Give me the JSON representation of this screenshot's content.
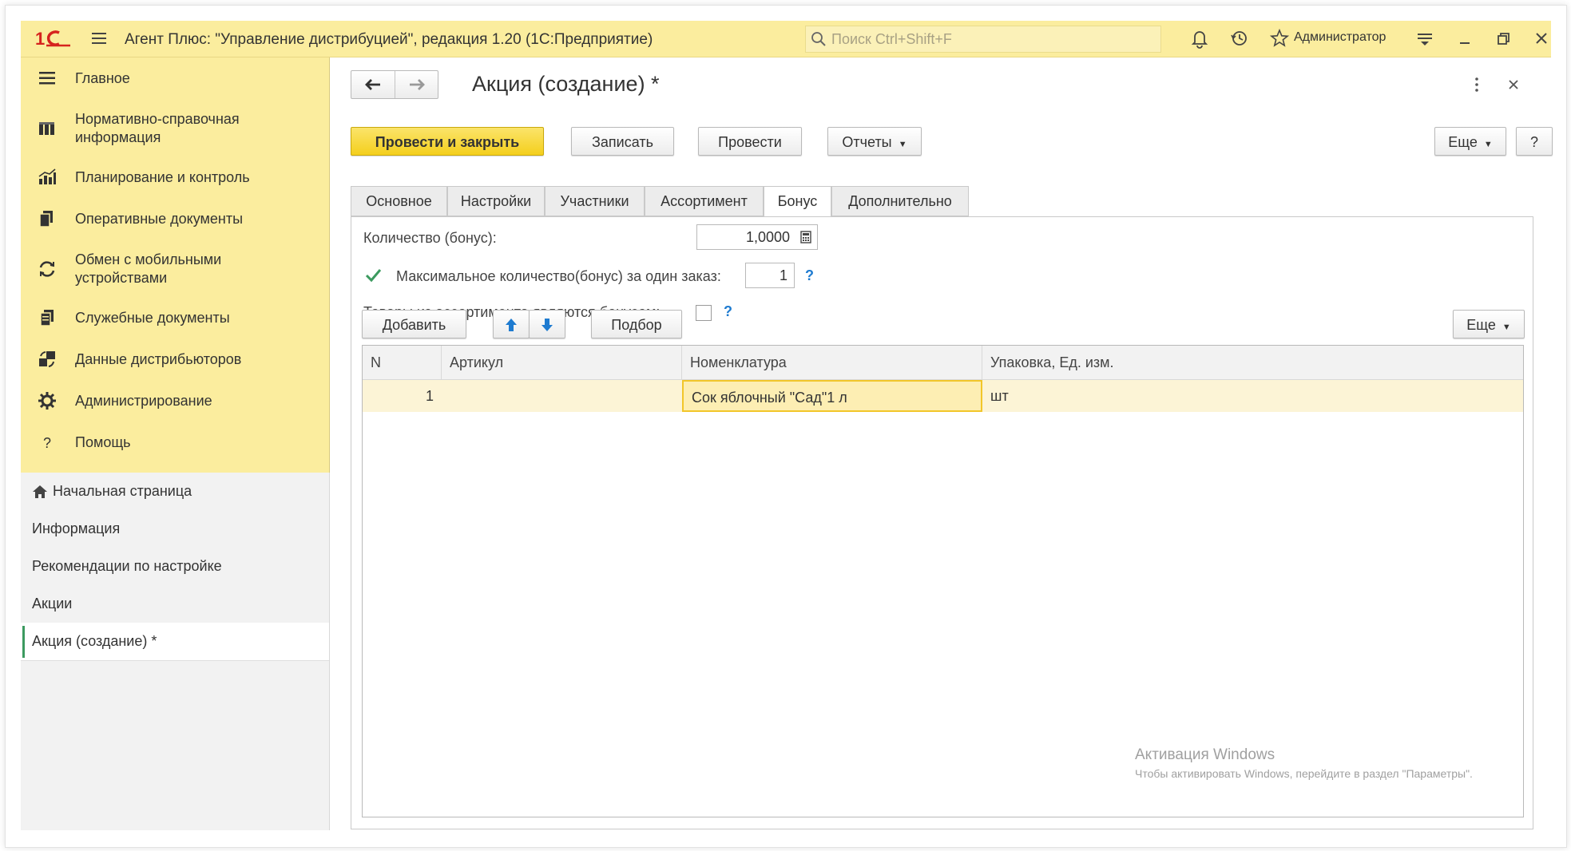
{
  "titlebar": {
    "app_title": "Агент Плюс: \"Управление дистрибуцией\", редакция 1.20  (1С:Предприятие)",
    "search_placeholder": "Поиск Ctrl+Shift+F",
    "user": "Администратор"
  },
  "sidebar": {
    "sections": [
      {
        "label": "Главное",
        "icon": "menu-icon"
      },
      {
        "label": "Нормативно-справочная информация",
        "icon": "catalog-icon"
      },
      {
        "label": "Планирование и контроль",
        "icon": "chart-icon"
      },
      {
        "label": "Оперативные документы",
        "icon": "documents-icon"
      },
      {
        "label": "Обмен с мобильными устройствами",
        "icon": "sync-icon"
      },
      {
        "label": "Служебные документы",
        "icon": "service-documents-icon"
      },
      {
        "label": "Данные дистрибьюторов",
        "icon": "distributors-icon"
      },
      {
        "label": "Администрирование",
        "icon": "gear-icon"
      },
      {
        "label": "Помощь",
        "icon": "question-icon"
      }
    ],
    "open_windows": [
      {
        "label": "Начальная страница",
        "icon": "home-icon"
      },
      {
        "label": "Информация"
      },
      {
        "label": "Рекомендации по настройке"
      },
      {
        "label": "Акции"
      },
      {
        "label": "Акция (создание) *"
      }
    ]
  },
  "form": {
    "title": "Акция (создание) *",
    "toolbar": {
      "post_close": "Провести и закрыть",
      "save": "Записать",
      "post": "Провести",
      "reports": "Отчеты",
      "more": "Еще",
      "help": "?"
    },
    "tabs": [
      "Основное",
      "Настройки",
      "Участники",
      "Ассортимент",
      "Бонус",
      "Дополнительно"
    ],
    "active_tab": "Бонус",
    "bonus": {
      "qty_label": "Количество (бонус):",
      "qty_value": "1,0000",
      "max_label": "Максимальное количество(бонус) за один заказ:",
      "max_value": "1",
      "max_checked": true,
      "goods_label": "Товары из ассортимента являются бонусом:",
      "goods_checked": false,
      "help": "?"
    },
    "table_toolbar": {
      "add": "Добавить",
      "pick": "Подбор",
      "more": "Еще"
    },
    "table": {
      "columns": [
        "N",
        "Артикул",
        "Номенклатура",
        "Упаковка, Ед. изм."
      ],
      "rows": [
        {
          "n": "1",
          "article": "",
          "item": "Сок яблочный \"Сад\"1 л",
          "unit": "шт"
        }
      ]
    }
  },
  "watermark": {
    "line1": "Активация Windows",
    "line2": "Чтобы активировать Windows, перейдите в раздел \"Параметры\"."
  },
  "colors": {
    "titlebar": "#fbed9e",
    "primary_button": "#f4cf1d",
    "selected_row": "#fcf4d6",
    "help_link": "#1e7bd0",
    "active_marker": "#3c9a5f"
  }
}
